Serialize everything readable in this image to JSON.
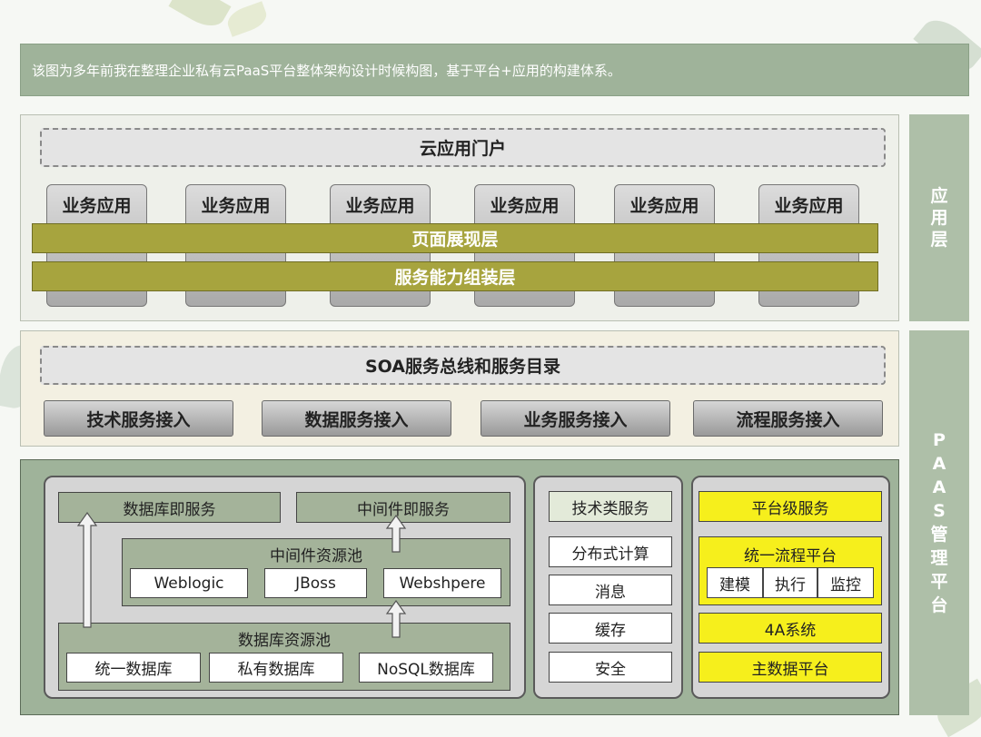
{
  "caption": "该图为多年前我在整理企业私有云PaaS平台整体架构设计时候构图，基于平台+应用的构建体系。",
  "side_labels": {
    "app_layer": "应\n用\n层",
    "paas": "P\nA\nA\nS\n管\n理\n平\n台"
  },
  "app_layer": {
    "portal": "云应用门户",
    "biz_apps": [
      "业务应用",
      "业务应用",
      "业务应用",
      "业务应用",
      "业务应用",
      "业务应用"
    ],
    "presentation": "页面展现层",
    "assembly": "服务能力组装层"
  },
  "soa_layer": {
    "bus": "SOA服务总线和服务目录",
    "access": [
      "技术服务接入",
      "数据服务接入",
      "业务服务接入",
      "流程服务接入"
    ]
  },
  "paas": {
    "dbaas": "数据库即服务",
    "mwaas": "中间件即服务",
    "mw_pool": {
      "title": "中间件资源池",
      "items": [
        "Weblogic",
        "JBoss",
        "Webshpere"
      ]
    },
    "db_pool": {
      "title": "数据库资源池",
      "items": [
        "统一数据库",
        "私有数据库",
        "NoSQL数据库"
      ]
    },
    "tech_services": {
      "title": "技术类服务",
      "items": [
        "分布式计算",
        "消息",
        "缓存",
        "安全"
      ]
    },
    "platform_services": {
      "title": "平台级服务",
      "workflow": {
        "title": "统一流程平台",
        "items": [
          "建模",
          "执行",
          "监控"
        ]
      },
      "fourA": "4A系统",
      "mdm": "主数据平台"
    }
  },
  "colors": {
    "caption_bg": "#9fb39a",
    "olive": "#a7a43e",
    "paas_bg": "#9fb39a",
    "yellow": "#f6ef1c"
  }
}
